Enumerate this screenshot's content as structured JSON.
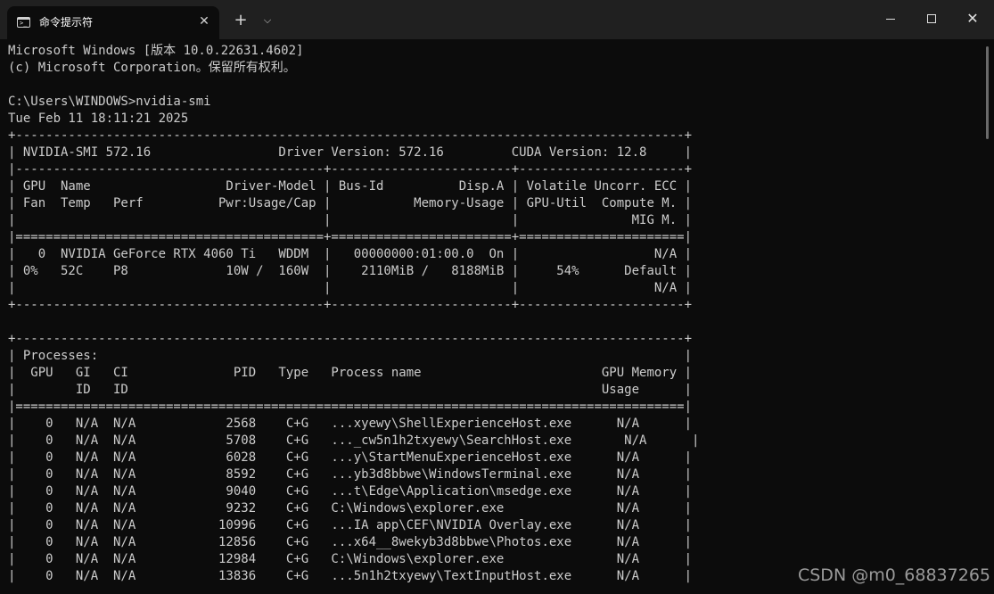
{
  "window": {
    "tab_title": "命令提示符",
    "tab_icon": "cmd-icon",
    "close_tab_glyph": "✕",
    "new_tab_glyph": "+",
    "dropdown_glyph": "⌵",
    "close_glyph": "✕"
  },
  "console_lines": [
    "Microsoft Windows [版本 10.0.22631.4602]",
    "(c) Microsoft Corporation。保留所有权利。",
    "",
    "C:\\Users\\WINDOWS>nvidia-smi",
    "Tue Feb 11 18:11:21 2025",
    "+-----------------------------------------------------------------------------------------+",
    "| NVIDIA-SMI 572.16                 Driver Version: 572.16         CUDA Version: 12.8     |",
    "|-----------------------------------------+------------------------+----------------------+",
    "| GPU  Name                  Driver-Model | Bus-Id          Disp.A | Volatile Uncorr. ECC |",
    "| Fan  Temp   Perf          Pwr:Usage/Cap |           Memory-Usage | GPU-Util  Compute M. |",
    "|                                         |                        |               MIG M. |",
    "|=========================================+========================+======================|",
    "|   0  NVIDIA GeForce RTX 4060 Ti   WDDM  |   00000000:01:00.0  On |                  N/A |",
    "| 0%   52C    P8             10W /  160W  |    2110MiB /   8188MiB |     54%      Default |",
    "|                                         |                        |                  N/A |",
    "+-----------------------------------------+------------------------+----------------------+",
    "",
    "+-----------------------------------------------------------------------------------------+",
    "| Processes:                                                                              |",
    "|  GPU   GI   CI              PID   Type   Process name                        GPU Memory |",
    "|        ID   ID                                                               Usage      |",
    "|=========================================================================================|",
    "|    0   N/A  N/A            2568    C+G   ...xyewy\\ShellExperienceHost.exe      N/A      |",
    "|    0   N/A  N/A            5708    C+G   ..._cw5n1h2txyewy\\SearchHost.exe       N/A      |",
    "|    0   N/A  N/A            6028    C+G   ...y\\StartMenuExperienceHost.exe      N/A      |",
    "|    0   N/A  N/A            8592    C+G   ...yb3d8bbwe\\WindowsTerminal.exe      N/A      |",
    "|    0   N/A  N/A            9040    C+G   ...t\\Edge\\Application\\msedge.exe      N/A      |",
    "|    0   N/A  N/A            9232    C+G   C:\\Windows\\explorer.exe               N/A      |",
    "|    0   N/A  N/A           10996    C+G   ...IA app\\CEF\\NVIDIA Overlay.exe      N/A      |",
    "|    0   N/A  N/A           12856    C+G   ...x64__8wekyb3d8bbwe\\Photos.exe      N/A      |",
    "|    0   N/A  N/A           12984    C+G   C:\\Windows\\explorer.exe               N/A      |",
    "|    0   N/A  N/A           13836    C+G   ...5n1h2txyewy\\TextInputHost.exe      N/A      |"
  ],
  "watermark": "CSDN @m0_68837265"
}
